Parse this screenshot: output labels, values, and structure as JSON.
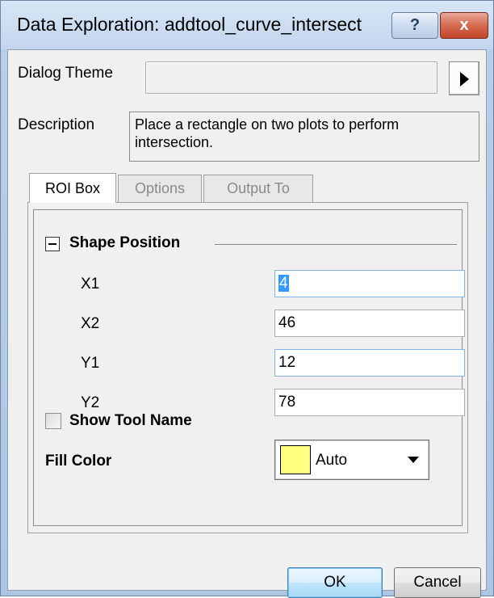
{
  "window": {
    "title": "Data Exploration: addtool_curve_intersect",
    "help_glyph": "?",
    "close_glyph": "x"
  },
  "dialog_theme": {
    "label": "Dialog Theme",
    "value": ""
  },
  "description": {
    "label": "Description",
    "text": "Place a rectangle on two plots to perform intersection."
  },
  "tabs": [
    {
      "label": "ROI Box",
      "active": true
    },
    {
      "label": "Options",
      "active": false
    },
    {
      "label": "Output To",
      "active": false
    }
  ],
  "shape_position": {
    "title": "Shape Position",
    "fields": [
      {
        "label": "X1",
        "value": "4"
      },
      {
        "label": "X2",
        "value": "46"
      },
      {
        "label": "Y1",
        "value": "12"
      },
      {
        "label": "Y2",
        "value": "78"
      }
    ]
  },
  "show_tool_name": {
    "label": "Show Tool Name",
    "checked": false
  },
  "fill_color": {
    "label": "Fill Color",
    "value": "Auto",
    "swatch_color": "#ffff80"
  },
  "buttons": {
    "ok": "OK",
    "cancel": "Cancel"
  }
}
